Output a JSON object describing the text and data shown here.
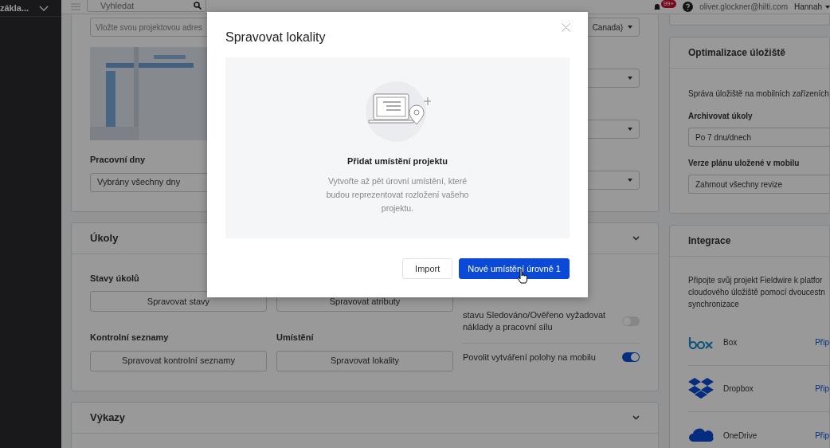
{
  "sidebar": {
    "project_name": "zákla..."
  },
  "header": {
    "search": {
      "placeholder": "Vyhledat"
    },
    "notifications_badge": "99+",
    "email": "oliver.glockner@hilti.com",
    "user": "Hannah"
  },
  "project_card": {
    "address": {
      "placeholder": "Vložte svou projektovou adres"
    },
    "working_days": {
      "label": "Pracovní dny",
      "value": "Vybrány všechny dny"
    },
    "right_selects": [
      {
        "kind": "select",
        "value": "Canada)"
      },
      {
        "kind": "select"
      },
      {
        "kind": "select"
      },
      {
        "kind": "select"
      }
    ]
  },
  "tasks_card": {
    "title": "Úkoly",
    "groups": [
      {
        "label": "Stavy úkolů",
        "button": "Spravovat stavy"
      },
      {
        "button": "Spravovat atributy"
      },
      {
        "label": "Kontrolní seznamy",
        "button": "Spravovat kontrolní seznamy"
      },
      {
        "label": "Umístění",
        "button": "Spravovat lokality"
      }
    ],
    "toggles": [
      {
        "label": "stavu Sledováno/Ověřeno vyžadovat náklady a pracovní sílu",
        "on": false
      },
      {
        "label": "Povolit vytváření polohy na mobilu",
        "on": true
      }
    ]
  },
  "reports_card": {
    "title": "Výkazy"
  },
  "storage_card": {
    "title": "Optimalizace úložiště",
    "description": "Správa úložiště na mobilních zařízeních",
    "fields": [
      {
        "label": "Archivovat úkoly",
        "value": "Po 7 dnu/dnech"
      },
      {
        "label": "Verze plánu uložené v mobilu",
        "value": "Zahrnout všechny revize"
      }
    ]
  },
  "integrations_card": {
    "title": "Integrace",
    "description_lines": [
      "Připojte svůj projekt Fieldwire k platfor",
      "cloudového úložiště pomocí dvoucestn",
      "synchronizace"
    ],
    "items": [
      {
        "kind": "box",
        "name": "Box",
        "action": "Přip"
      },
      {
        "kind": "dropbox",
        "name": "Dropbox",
        "action": "Přip"
      },
      {
        "kind": "onedrive",
        "name": "OneDrive",
        "action": "Přip"
      }
    ]
  },
  "modal": {
    "title": "Spravovat lokality",
    "empty_title": "Přidat umístění projektu",
    "empty_text": "Vytvořte až pět úrovní umístění, které budou reprezentovat rozložení vašeho projektu.",
    "buttons": [
      {
        "kind": "secondary",
        "label": "Import"
      },
      {
        "kind": "primary",
        "label": "Nové umístění úrovně 1"
      }
    ]
  }
}
